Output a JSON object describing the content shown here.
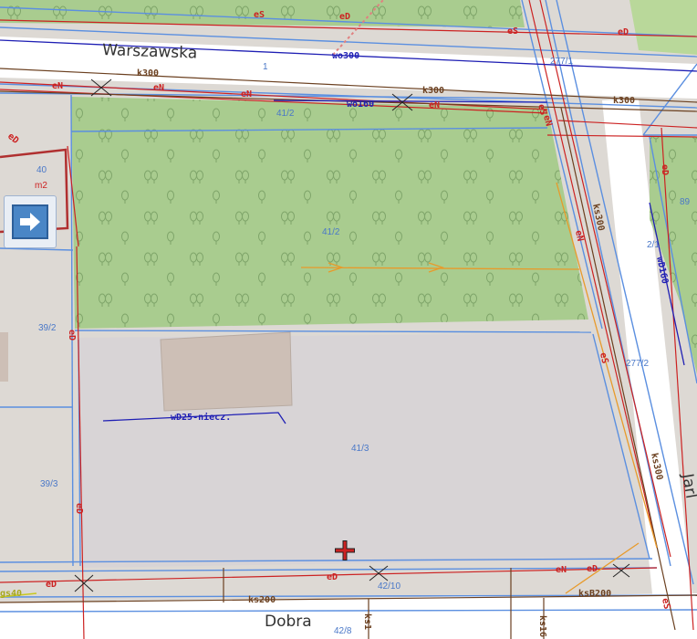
{
  "streets": {
    "top": "Warszawska",
    "bottom": "Dobra",
    "right": "Jarl"
  },
  "parcels": {
    "p1": "1",
    "p277_1": "277/1",
    "p41_2": "41/2",
    "p41_2_center": "41/2",
    "p40": "40",
    "m2": "m2",
    "p39_2": "39/2",
    "p39_3": "39/3",
    "p41_3": "41/3",
    "p42_10": "42/10",
    "p42_8": "42/8",
    "p277_2": "277/2",
    "p2_1": "2/1",
    "p89": "89"
  },
  "utilities": {
    "eS_top1": "eS",
    "eD_top1": "eD",
    "eS_top2": "eS",
    "eD_top2": "eD",
    "k300_top": "k300",
    "wo300": "wo300",
    "eN_1": "eN",
    "eN_2": "eN",
    "eN_3": "eN",
    "k300_mid": "k300",
    "k300_right": "k300",
    "wo160": "wo160",
    "eN_4": "eN",
    "eS_right": "eS",
    "eN_right": "eN",
    "eD_left_top": "eD",
    "eD_left_mid": "eD",
    "eD_left_low": "eD",
    "ks300_1": "ks300",
    "eN_diag": "eN",
    "wD160": "wD160",
    "ks300_2": "ks300",
    "eS_diag": "eS",
    "eD_rightcol": "eD",
    "wD25": "wD25-niecz.",
    "eD_bot1": "eD",
    "eD_bot2": "eD",
    "eN_bot": "eN",
    "eD_bot3": "eD",
    "ks200": "ks200",
    "ksB200": "ksB200",
    "gs40": "gs40",
    "eS_bot": "eS",
    "ks_vert1": "ks1",
    "ks_vert2": "ks16"
  },
  "controls": {
    "nav_label": "next-arrow"
  },
  "colors": {
    "green_area": "#a9cc8f",
    "parcel_line": "#5b8fe0",
    "power_line": "#cc2222",
    "sewer_line": "#6b4020",
    "water_line": "#1f1fb4",
    "gas_line": "#e89a2a",
    "building": "#cdbfb6"
  }
}
